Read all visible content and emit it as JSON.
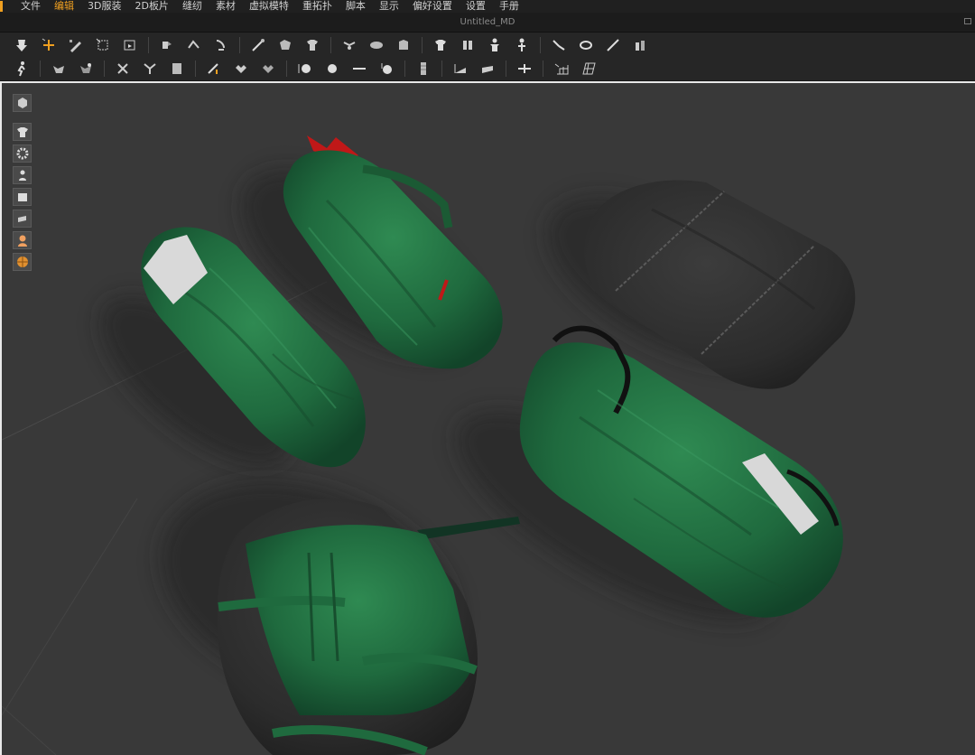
{
  "menu": {
    "items": [
      {
        "label": "文件",
        "active": false
      },
      {
        "label": "编辑",
        "active": true
      },
      {
        "label": "3D服装",
        "active": false
      },
      {
        "label": "2D板片",
        "active": false
      },
      {
        "label": "缝纫",
        "active": false
      },
      {
        "label": "素材",
        "active": false
      },
      {
        "label": "虚拟模特",
        "active": false
      },
      {
        "label": "重拓扑",
        "active": false
      },
      {
        "label": "脚本",
        "active": false
      },
      {
        "label": "显示",
        "active": false
      },
      {
        "label": "偏好设置",
        "active": false
      },
      {
        "label": "设置",
        "active": false
      },
      {
        "label": "手册",
        "active": false
      }
    ]
  },
  "window": {
    "title": "Untitled_MD"
  },
  "colors": {
    "accent": "#f0a020",
    "bag_green": "#1f6a3e",
    "bag_dark": "#2c2c2c",
    "viewport_bg": "#393939"
  },
  "toolbar_row1": [
    "select-move-icon",
    "add-point-icon",
    "edit-pattern-icon",
    "transform-icon",
    "texture-icon",
    "fold-icon",
    "fold-arrange-icon",
    "fold-strip-icon",
    "pin-icon",
    "garment-icon",
    "shirt-icon",
    "arrange-icon",
    "garment-pack-icon",
    "garment-lock-icon",
    "shirt-front-icon",
    "shirt-back-icon",
    "avatar-icon",
    "avatar-up-icon",
    "measure-icon",
    "tape-icon",
    "needle-icon",
    "brush-icon"
  ],
  "toolbar_row2": [
    "walk-icon",
    "simulate-icon",
    "sim-settings-icon",
    "pose-icon",
    "ik-icon",
    "sewing-icon",
    "segment-sew-icon",
    "free-sew-icon",
    "multi-sew-icon",
    "button-icon",
    "circle-button-icon",
    "line-icon",
    "zipper-icon",
    "zipper-puller-icon",
    "topstitch-icon",
    "fabric-icon",
    "move-icon",
    "grid-icon",
    "uv-grid-icon"
  ],
  "sidebar_tools": [
    "cube-view-icon",
    "garment-view-icon",
    "gear-view-icon",
    "avatar-view-icon",
    "pattern-view-icon",
    "fabric-view-icon",
    "avatar-skin-icon",
    "globe-icon"
  ]
}
